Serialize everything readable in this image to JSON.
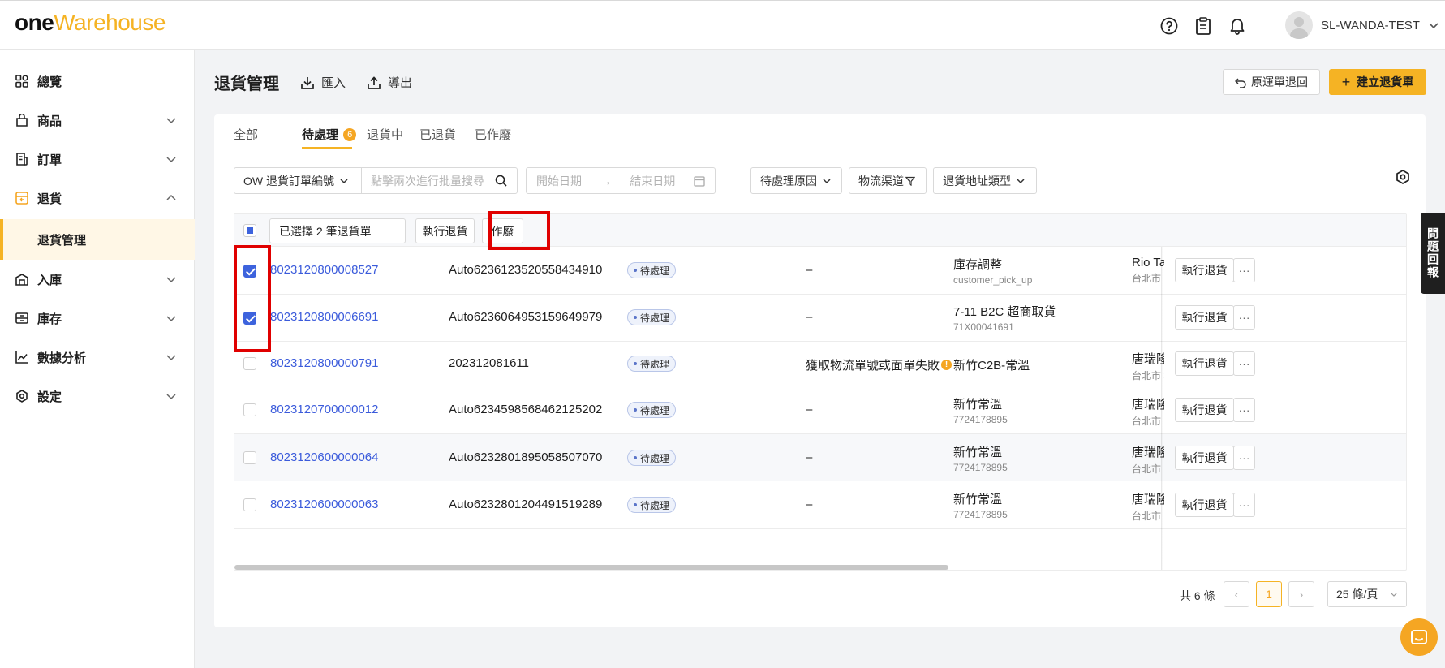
{
  "header": {
    "logo_one": "one",
    "logo_warehouse": "Warehouse",
    "username": "SL-WANDA-TEST"
  },
  "sidebar": {
    "items": [
      {
        "label": "總覽",
        "icon": "dashboard-icon"
      },
      {
        "label": "商品",
        "icon": "product-icon"
      },
      {
        "label": "訂單",
        "icon": "order-icon"
      },
      {
        "label": "退貨",
        "icon": "return-icon"
      },
      {
        "label": "退貨管理"
      },
      {
        "label": "入庫",
        "icon": "inbound-icon"
      },
      {
        "label": "庫存",
        "icon": "inventory-icon"
      },
      {
        "label": "數據分析",
        "icon": "analytics-icon"
      },
      {
        "label": "設定",
        "icon": "settings-icon"
      }
    ]
  },
  "page": {
    "title": "退貨管理",
    "import_label": "匯入",
    "export_label": "導出",
    "original_return_label": "原運單退回",
    "create_label": "建立退貨單"
  },
  "tabs": [
    {
      "label": "全部"
    },
    {
      "label": "待處理",
      "badge": "6"
    },
    {
      "label": "退貨中"
    },
    {
      "label": "已退貨"
    },
    {
      "label": "已作廢"
    }
  ],
  "filters": {
    "search_type": "OW 退貨訂單編號",
    "search_placeholder": "點擊兩次進行批量搜尋",
    "start_date_placeholder": "開始日期",
    "end_date_placeholder": "結束日期",
    "pending_reason": "待處理原因",
    "logistics_channel": "物流渠道",
    "return_address_type": "退貨地址類型"
  },
  "bulk": {
    "selected_text": "已選擇 2 筆退貨單",
    "execute_label": "執行退貨",
    "void_label": "作廢"
  },
  "rows": [
    {
      "id": "8023120800008527",
      "ref": "Auto6236123520558434910",
      "status": "待處理",
      "reason": "–",
      "logistics": "庫存調整",
      "logistics_sub": "customer_pick_up",
      "contact": "Rio Tar",
      "contact_sub": "台北市 中",
      "action": "執行退貨"
    },
    {
      "id": "8023120800006691",
      "ref": "Auto6236064953159649979",
      "status": "待處理",
      "reason": "–",
      "logistics": "7-11 B2C 超商取貨",
      "logistics_sub": "71X00041691",
      "contact": "",
      "contact_sub": "",
      "action": "執行退貨"
    },
    {
      "id": "8023120800000791",
      "ref": "202312081611",
      "status": "待處理",
      "reason": "獲取物流單號或面單失敗",
      "logistics": "新竹C2B-常溫",
      "logistics_sub": "",
      "contact": "唐瑞隆",
      "contact_sub": "台北市 松",
      "action": "執行退貨"
    },
    {
      "id": "8023120700000012",
      "ref": "Auto6234598568462125202",
      "status": "待處理",
      "reason": "–",
      "logistics": "新竹常溫",
      "logistics_sub": "7724178895",
      "contact": "唐瑞隆",
      "contact_sub": "台北市 萬",
      "action": "執行退貨"
    },
    {
      "id": "8023120600000064",
      "ref": "Auto6232801895058507070",
      "status": "待處理",
      "reason": "–",
      "logistics": "新竹常溫",
      "logistics_sub": "7724178895",
      "contact": "唐瑞隆",
      "contact_sub": "台北市 萬",
      "action": "執行退貨"
    },
    {
      "id": "8023120600000063",
      "ref": "Auto6232801204491519289",
      "status": "待處理",
      "reason": "–",
      "logistics": "新竹常溫",
      "logistics_sub": "7724178895",
      "contact": "唐瑞隆",
      "contact_sub": "台北市 萬",
      "action": "執行退貨"
    }
  ],
  "pagination": {
    "total": "共 6 條",
    "current": "1",
    "page_size": "25 條/頁"
  },
  "feedback_label": "問題回報",
  "colors": {
    "accent": "#f5b324",
    "link": "#3b5bdb",
    "highlight": "#e00000"
  }
}
